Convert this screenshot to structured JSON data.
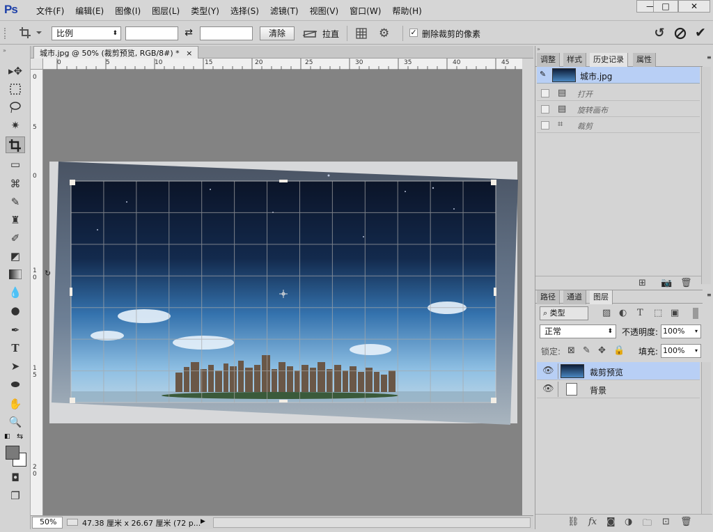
{
  "app": {
    "logo": "Ps"
  },
  "menu": [
    "文件(F)",
    "编辑(E)",
    "图像(I)",
    "图层(L)",
    "类型(Y)",
    "选择(S)",
    "滤镜(T)",
    "视图(V)",
    "窗口(W)",
    "帮助(H)"
  ],
  "window_controls": {
    "minimize": "—",
    "restore": "□",
    "close": "✕"
  },
  "options": {
    "ratio_select": "比例",
    "clear_label": "清除",
    "straighten_label": "拉直",
    "delete_pixels_label": "删除裁剪的像素",
    "delete_pixels_checked": true,
    "swap_glyph": "⇄"
  },
  "document": {
    "tab_title": "城市.jpg @ 50% (裁剪预览, RGB/8#) *",
    "tab_close": "×",
    "h_ruler_ticks": [
      "0",
      "5",
      "10",
      "15",
      "20",
      "25",
      "30",
      "35",
      "40",
      "45"
    ],
    "v_ruler_ticks": [
      "0",
      "5",
      "0",
      "1\n0",
      "1\n5",
      "2\n0"
    ]
  },
  "status": {
    "zoom": "50%",
    "doc_size": "47.38 厘米 x 26.67 厘米 (72 p...",
    "arrow": "▶"
  },
  "history_panel": {
    "tabs": [
      "调整",
      "样式",
      "历史记录",
      "属性"
    ],
    "active_tab": "历史记录",
    "snapshot": "城市.jpg",
    "items": [
      "打开",
      "旋转画布",
      "裁剪"
    ]
  },
  "layers_panel": {
    "tabs": [
      "路径",
      "通道",
      "图层"
    ],
    "active_tab": "图层",
    "filter_kind": "类型",
    "blend_mode": "正常",
    "opacity_label": "不透明度:",
    "opacity_value": "100%",
    "lock_label": "锁定:",
    "fill_label": "填充:",
    "fill_value": "100%",
    "layers": [
      {
        "name": "裁剪预览",
        "selected": true
      },
      {
        "name": "背景",
        "selected": false
      }
    ],
    "footer_icons": [
      "link-icon",
      "fx-icon",
      "mask-icon",
      "adjustment-icon",
      "group-icon",
      "new-layer-icon",
      "delete-icon"
    ],
    "fx_text": "fx"
  },
  "colors": {
    "accent_select": "#b8cff5",
    "canvas_bg": "#838383",
    "sky_top": "#0b1830",
    "sky_bottom": "#5f9fd2"
  }
}
